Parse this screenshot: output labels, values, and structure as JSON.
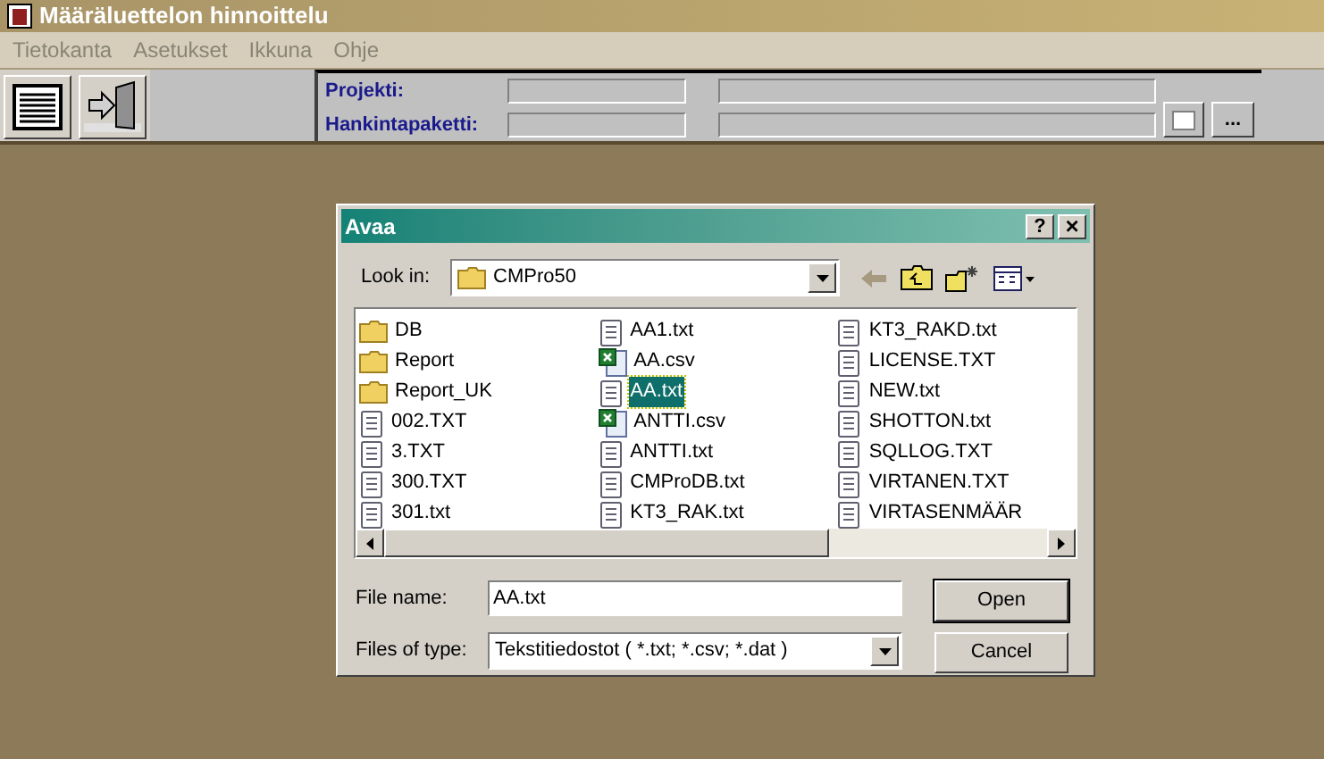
{
  "window": {
    "title": "Määräluettelon hinnoittelu"
  },
  "menu": [
    "Tietokanta",
    "Asetukset",
    "Ikkuna",
    "Ohje"
  ],
  "header": {
    "labels": [
      "Projekti:",
      "Hankintapaketti:"
    ]
  },
  "header_button": "...",
  "dialog": {
    "title": "Avaa",
    "help": "?",
    "close": "×",
    "look_in_label": "Look in:",
    "look_in_value": "CMPro50",
    "files": [
      {
        "name": "DB",
        "kind": "folder",
        "selected": false
      },
      {
        "name": "Report",
        "kind": "folder",
        "selected": false
      },
      {
        "name": "Report_UK",
        "kind": "folder",
        "selected": false
      },
      {
        "name": "002.TXT",
        "kind": "text",
        "selected": false
      },
      {
        "name": "3.TXT",
        "kind": "text",
        "selected": false
      },
      {
        "name": "300.TXT",
        "kind": "text",
        "selected": false
      },
      {
        "name": "301.txt",
        "kind": "text",
        "selected": false
      },
      {
        "name": "AA1.txt",
        "kind": "text",
        "selected": false
      },
      {
        "name": "AA.csv",
        "kind": "sheet",
        "selected": false
      },
      {
        "name": "AA.txt",
        "kind": "text",
        "selected": true
      },
      {
        "name": "ANTTI.csv",
        "kind": "sheet",
        "selected": false
      },
      {
        "name": "ANTTI.txt",
        "kind": "text",
        "selected": false
      },
      {
        "name": "CMProDB.txt",
        "kind": "text",
        "selected": false
      },
      {
        "name": "KT3_RAK.txt",
        "kind": "text",
        "selected": false
      },
      {
        "name": "KT3_RAKD.txt",
        "kind": "text",
        "selected": false
      },
      {
        "name": "LICENSE.TXT",
        "kind": "text",
        "selected": false
      },
      {
        "name": "NEW.txt",
        "kind": "text",
        "selected": false
      },
      {
        "name": "SHOTTON.txt",
        "kind": "text",
        "selected": false
      },
      {
        "name": "SQLLOG.TXT",
        "kind": "text",
        "selected": false
      },
      {
        "name": "VIRTANEN.TXT",
        "kind": "text",
        "selected": false
      },
      {
        "name": "VIRTASENMÄÄR",
        "kind": "text",
        "selected": false
      }
    ],
    "file_name_label": "File name:",
    "file_name_value": "AA.txt",
    "file_type_label": "Files of type:",
    "file_type_value": "Tekstitiedostot ( *.txt; *.csv; *.dat )",
    "buttons": [
      "Open",
      "Cancel"
    ]
  }
}
